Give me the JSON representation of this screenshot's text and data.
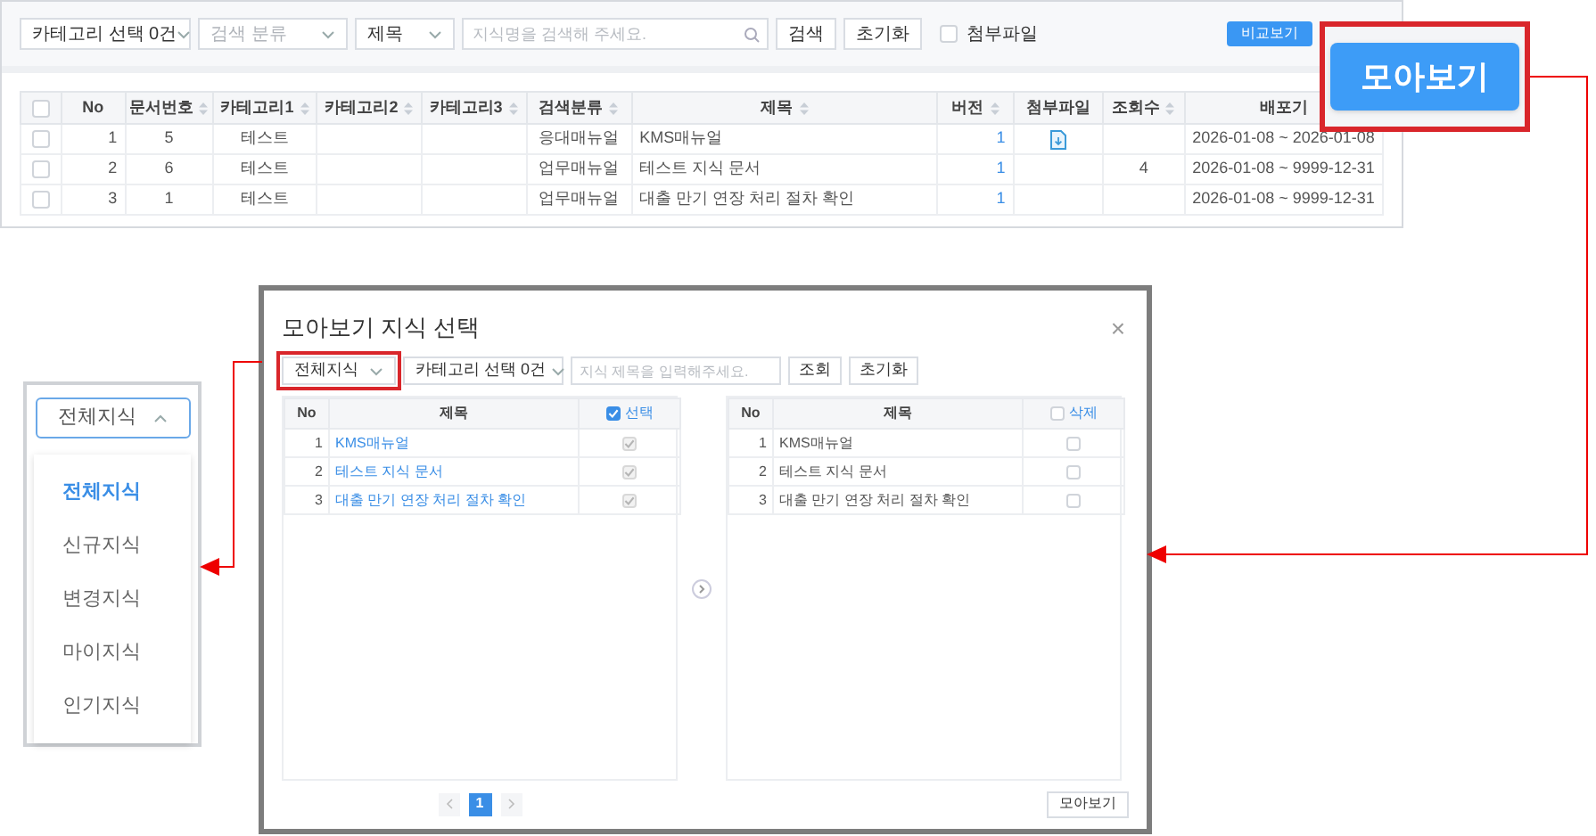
{
  "main_screen": {
    "filters": {
      "category_select": "카테고리 선택 0건",
      "search_type": {
        "placeholder": "검색 분류"
      },
      "field_select": "제목",
      "search": {
        "placeholder": "지식명을 검색해 주세요."
      },
      "buttons": [
        "검색",
        "초기화"
      ],
      "attachment_checkbox": {
        "label": "첨부파일",
        "checked": false
      },
      "compare_button": "비교보기"
    },
    "table": {
      "header_checked": false,
      "columns": [
        {
          "label": "No",
          "sortable": false
        },
        {
          "label": "문서번호",
          "sortable": true
        },
        {
          "label": "카테고리1",
          "sortable": true
        },
        {
          "label": "카테고리2",
          "sortable": true
        },
        {
          "label": "카테고리3",
          "sortable": true
        },
        {
          "label": "검색분류",
          "sortable": true
        },
        {
          "label": "제목",
          "sortable": true
        },
        {
          "label": "버전",
          "sortable": true
        },
        {
          "label": "첨부파일",
          "sortable": false
        },
        {
          "label": "조회수",
          "sortable": true
        },
        {
          "label": "배포기",
          "sortable": false
        }
      ],
      "rows": [
        {
          "checked": false,
          "no": "1",
          "doc_no": "5",
          "category1": "테스트",
          "search_type": "응대매뉴얼",
          "title": "KMS매뉴얼",
          "version": "1",
          "attachment": true,
          "period": "2026-01-08 ~ 2026-01-08"
        },
        {
          "checked": false,
          "no": "2",
          "doc_no": "6",
          "category1": "테스트",
          "search_type": "업무매뉴얼",
          "title": "테스트 지식 문서",
          "version": "1",
          "attachment": false,
          "views": "4",
          "period": "2026-01-08 ~ 9999-12-31"
        },
        {
          "checked": false,
          "no": "3",
          "doc_no": "1",
          "category1": "테스트",
          "search_type": "업무매뉴얼",
          "title": "대출 만기 연장 처리 절차 확인",
          "version": "1",
          "attachment": false,
          "period": "2026-01-08 ~ 9999-12-31"
        }
      ]
    }
  },
  "callout_button": "모아보기",
  "modal": {
    "title": "모아보기 지식 선택",
    "close": "×",
    "scope_select": "전체지식",
    "category_select": "카테고리 선택 0건",
    "search": {
      "placeholder": "지식 제목을 입력해주세요."
    },
    "buttons": [
      "조회",
      "초기화"
    ],
    "left_table": {
      "columns": [
        "No",
        "제목"
      ],
      "select_header": {
        "label": "선택",
        "checked": true
      },
      "rows": [
        {
          "no": "1",
          "title": "KMS매뉴얼",
          "checked": true
        },
        {
          "no": "2",
          "title": "테스트 지식 문서",
          "checked": true
        },
        {
          "no": "3",
          "title": "대출 만기 연장 처리 절차 확인",
          "checked": true
        }
      ]
    },
    "right_table": {
      "columns": [
        "No",
        "제목"
      ],
      "select_header": {
        "label": "삭제",
        "checked": false
      },
      "rows": [
        {
          "no": "1",
          "title": "KMS매뉴얼",
          "checked": false
        },
        {
          "no": "2",
          "title": "테스트 지식 문서",
          "checked": false
        },
        {
          "no": "3",
          "title": "대출 만기 연장 처리 절차 확인",
          "checked": false
        }
      ]
    },
    "pagination": [
      {
        "label": "1",
        "selected": true
      }
    ],
    "submit_button": "모아보기"
  },
  "dropdown": {
    "value": "전체지식",
    "expanded": true,
    "options": [
      {
        "label": "전체지식",
        "selected": true
      },
      {
        "label": "신규지식",
        "selected": false
      },
      {
        "label": "변경지식",
        "selected": false
      },
      {
        "label": "마이지식",
        "selected": false
      },
      {
        "label": "인기지식",
        "selected": false
      }
    ]
  }
}
